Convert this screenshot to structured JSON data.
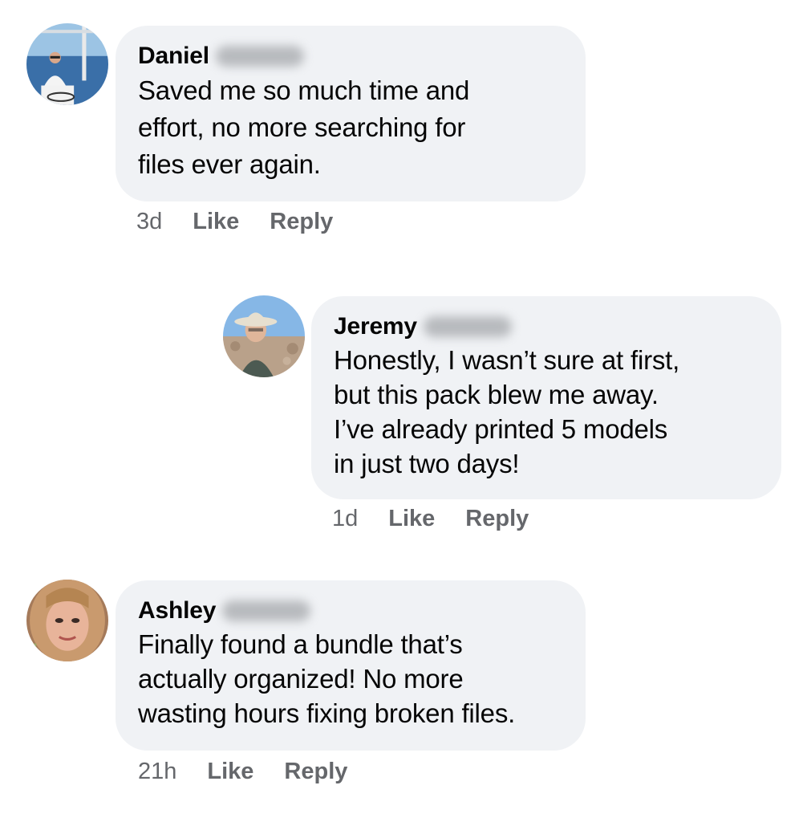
{
  "comments": [
    {
      "author": "Daniel",
      "text_lines": [
        "Saved me so much time and",
        "effort, no more searching for",
        "files ever again."
      ],
      "time": "3d",
      "like_label": "Like",
      "reply_label": "Reply",
      "avatar_icon": "person-on-boat-avatar"
    },
    {
      "author": "Jeremy",
      "text_lines": [
        "Honestly, I wasn’t sure at first,",
        "but this pack blew me away.",
        "I’ve already printed 5 models",
        "in just two days!"
      ],
      "time": "1d",
      "like_label": "Like",
      "reply_label": "Reply",
      "avatar_icon": "man-with-hat-avatar"
    },
    {
      "author": "Ashley",
      "text_lines": [
        "Finally found a bundle that’s",
        "actually organized! No more",
        "wasting hours fixing broken files."
      ],
      "time": "21h",
      "like_label": "Like",
      "reply_label": "Reply",
      "avatar_icon": "woman-selfie-avatar"
    }
  ],
  "colors": {
    "bubble": "#f0f2f5",
    "meta_text": "#65676b",
    "body_text": "#050505"
  }
}
